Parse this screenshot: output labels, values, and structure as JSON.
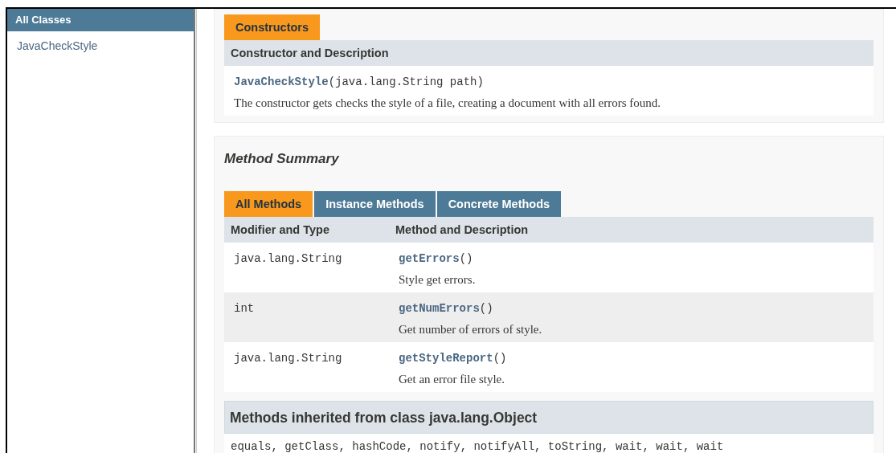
{
  "sidebar": {
    "title": "All Classes",
    "items": [
      {
        "label": "JavaCheckStyle"
      }
    ]
  },
  "constructors": {
    "caption": "Constructors",
    "header": "Constructor and Description",
    "rows": [
      {
        "name": "JavaCheckStyle",
        "params": "(java.lang.String path)",
        "description": "The constructor gets checks the style of a file, creating a document with all errors found."
      }
    ]
  },
  "method_summary": {
    "title": "Method Summary",
    "tabs": [
      {
        "label": "All Methods",
        "selected": true
      },
      {
        "label": "Instance Methods",
        "selected": false
      },
      {
        "label": "Concrete Methods",
        "selected": false
      }
    ],
    "columns": [
      "Modifier and Type",
      "Method and Description"
    ],
    "rows": [
      {
        "type": "java.lang.String",
        "signature": "**getErrors**()",
        "description": "Style get errors."
      },
      {
        "type": "int",
        "signature": "**getNumErrors**()",
        "description": "Get number of errors of style."
      },
      {
        "type": "java.lang.String",
        "signature": "**getStyleReport**()",
        "description": "Get an error file style."
      }
    ]
  },
  "inherited": {
    "title": "Methods inherited from class java.lang.Object",
    "methods": "equals, getClass, hashCode, notify, notifyAll, toString, wait, wait, wait"
  }
}
